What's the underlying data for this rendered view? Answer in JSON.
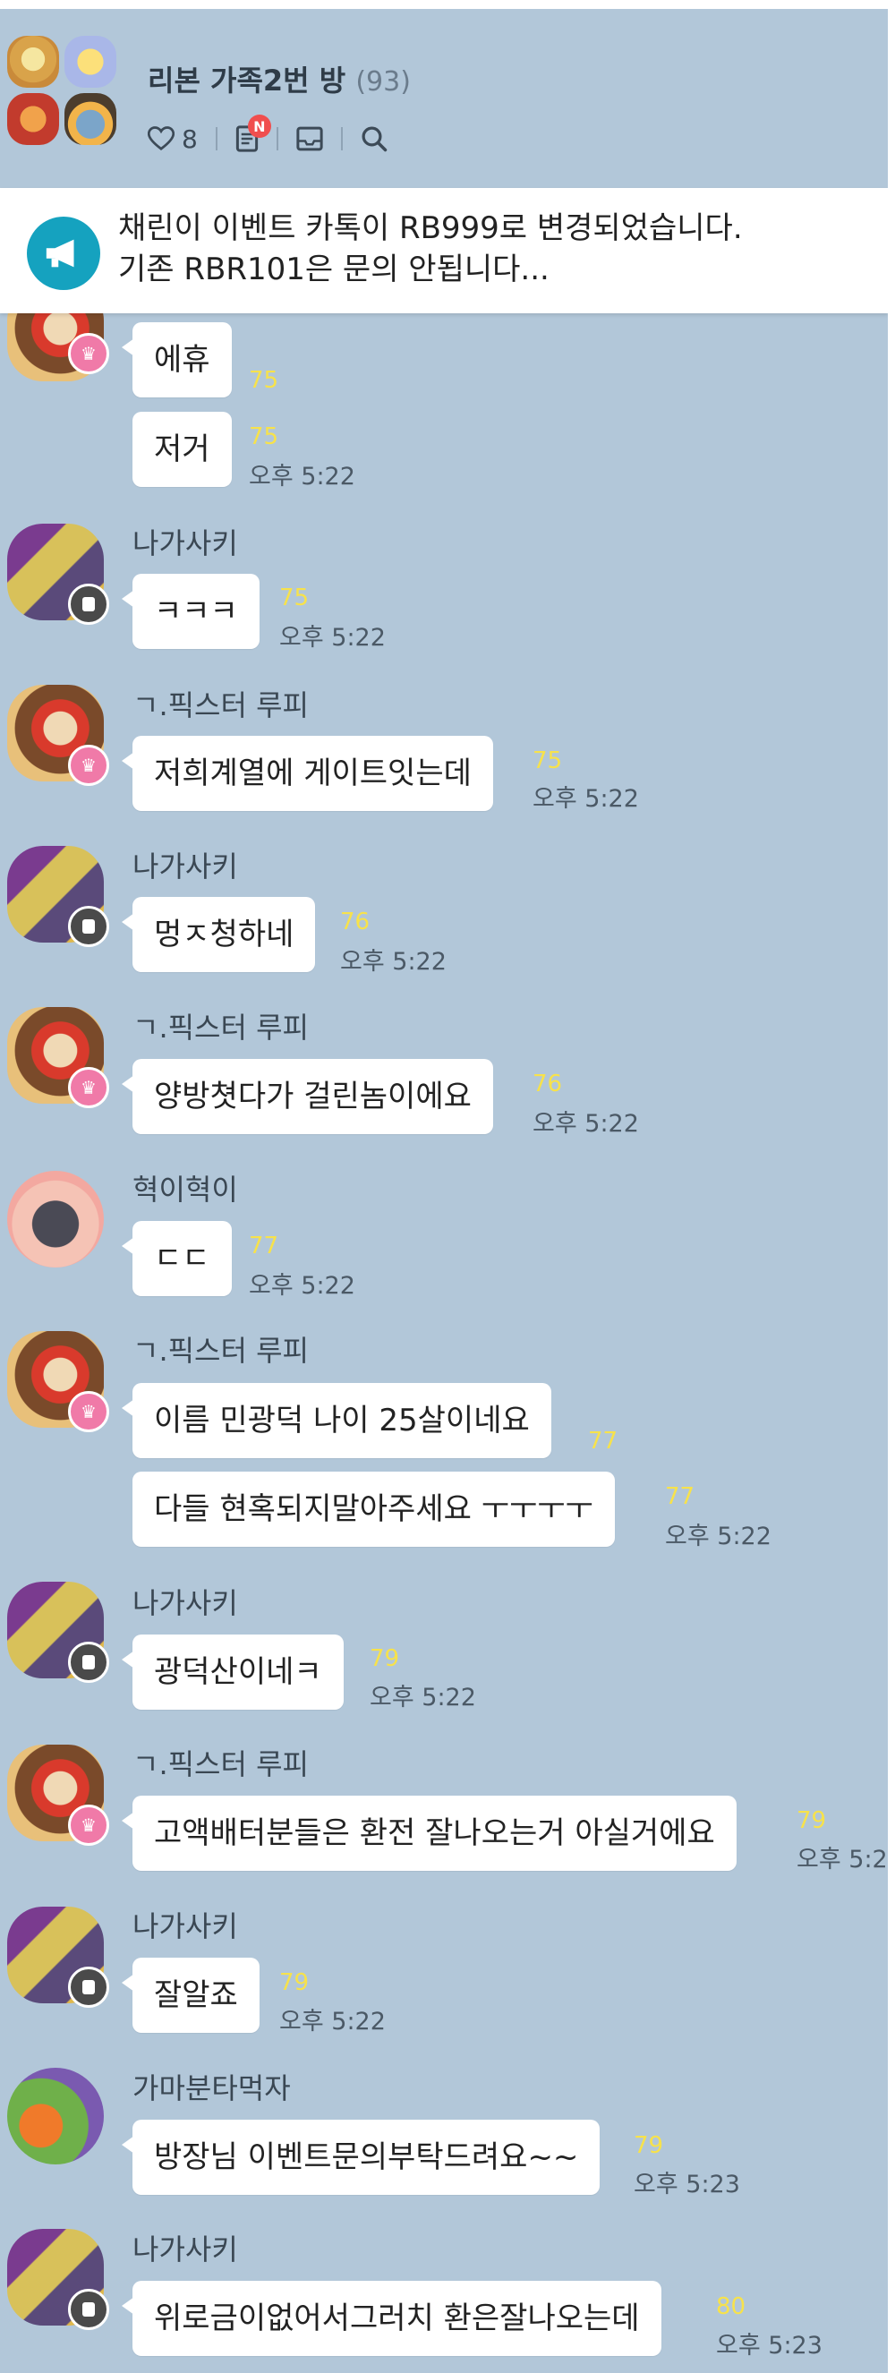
{
  "header": {
    "title": "리본 가족2번 방",
    "member_count": "(93)",
    "likes": "8",
    "new_badge": "N",
    "icons": [
      "heart-icon",
      "board-icon",
      "inbox-icon",
      "search-icon"
    ]
  },
  "notice": {
    "line1": "채린이 이벤트 카톡이 RB999로 변경되었습니다.",
    "line2": "기존 RBR101은 문의 안됩니다..."
  },
  "messages": [
    {
      "sender": "",
      "text": "에휴",
      "unread": "75",
      "time": ""
    },
    {
      "sender": "",
      "text": "저거",
      "unread": "75",
      "time": "오후 5:22"
    },
    {
      "sender": "나가사키",
      "text": "ㅋㅋㅋ",
      "unread": "75",
      "time": "오후 5:22"
    },
    {
      "sender": "ㄱ.픽스터 루피",
      "text": "저희계열에 게이트잇는데",
      "unread": "75",
      "time": "오후 5:22"
    },
    {
      "sender": "나가사키",
      "text": "멍ㅈ청하네",
      "unread": "76",
      "time": "오후 5:22"
    },
    {
      "sender": "ㄱ.픽스터 루피",
      "text": "양방쳣다가 걸린놈이에요",
      "unread": "76",
      "time": "오후 5:22"
    },
    {
      "sender": "혁이혁이",
      "text": "ㄷㄷ",
      "unread": "77",
      "time": "오후 5:22"
    },
    {
      "sender": "ㄱ.픽스터 루피",
      "text": "이름 민광덕 나이 25살이네요",
      "unread": "77",
      "time": ""
    },
    {
      "sender": "",
      "text": "다들 현혹되지말아주세요 ㅜㅜㅜㅜ",
      "unread": "77",
      "time": "오후 5:22"
    },
    {
      "sender": "나가사키",
      "text": "광덕산이네ㅋ",
      "unread": "79",
      "time": "오후 5:22"
    },
    {
      "sender": "ㄱ.픽스터 루피",
      "text": "고액배터분들은 환전 잘나오는거 아실거에요",
      "unread": "79",
      "time": "오후 5:2"
    },
    {
      "sender": "나가사키",
      "text": "잘알죠",
      "unread": "79",
      "time": "오후 5:22"
    },
    {
      "sender": "가마분타먹자",
      "text": "방장님 이벤트문의부탁드려요~~",
      "unread": "79",
      "time": "오후 5:23"
    },
    {
      "sender": "나가사키",
      "text": "위로금이없어서그러치 환은잘나오는데",
      "unread": "80",
      "time": "오후 5:23"
    }
  ]
}
